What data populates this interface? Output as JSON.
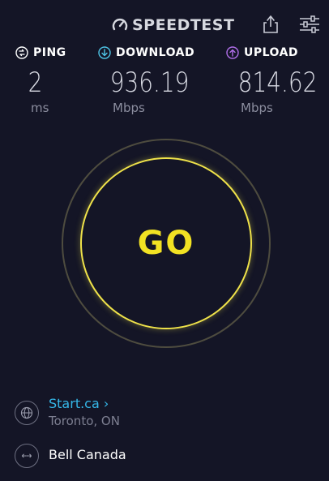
{
  "header": {
    "brand": "SPEEDTEST",
    "share_icon": "share-icon",
    "settings_icon": "sliders-icon"
  },
  "metrics": {
    "ping": {
      "label": "PING",
      "value": "2",
      "unit": "ms",
      "icon": "ping-icon",
      "color": "#ffffff"
    },
    "download": {
      "label": "DOWNLOAD",
      "value": "936.19",
      "unit": "Mbps",
      "icon": "download-arrow-icon",
      "color": "#4ec4e6"
    },
    "upload": {
      "label": "UPLOAD",
      "value": "814.62",
      "unit": "Mbps",
      "icon": "upload-arrow-icon",
      "color": "#b06ee8"
    }
  },
  "go_button": {
    "label": "GO",
    "color": "#f2e223"
  },
  "server": {
    "name": "Start.ca",
    "chevron": "›",
    "location": "Toronto, ON",
    "icon": "globe-icon"
  },
  "isp": {
    "name": "Bell Canada",
    "icon": "connection-icon"
  },
  "colors": {
    "background": "#141526",
    "link": "#35b7e8"
  }
}
